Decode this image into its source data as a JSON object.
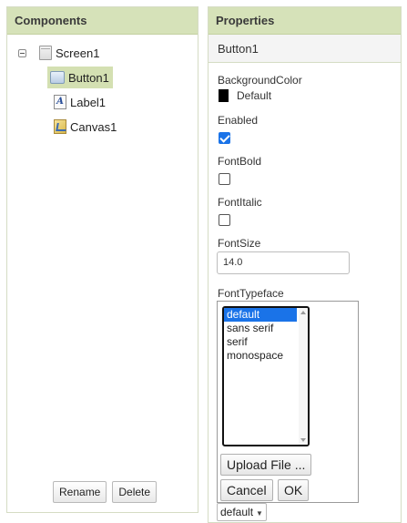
{
  "components_panel": {
    "title": "Components",
    "tree": {
      "root": {
        "label": "Screen1",
        "icon": "screen-icon"
      },
      "children": [
        {
          "label": "Button1",
          "icon": "button-component-icon",
          "selected": true
        },
        {
          "label": "Label1",
          "icon": "label-component-icon",
          "selected": false
        },
        {
          "label": "Canvas1",
          "icon": "canvas-component-icon",
          "selected": false
        }
      ]
    },
    "rename_label": "Rename",
    "delete_label": "Delete"
  },
  "properties_panel": {
    "title": "Properties",
    "component_name": "Button1",
    "background_color": {
      "label": "BackgroundColor",
      "value": "Default",
      "swatch": "#000000"
    },
    "enabled": {
      "label": "Enabled",
      "checked": true
    },
    "font_bold": {
      "label": "FontBold",
      "checked": false
    },
    "font_italic": {
      "label": "FontItalic",
      "checked": false
    },
    "font_size": {
      "label": "FontSize",
      "value": "14.0"
    },
    "font_typeface": {
      "label": "FontTypeface",
      "options": [
        "default",
        "sans serif",
        "serif",
        "monospace"
      ],
      "selected": "default",
      "upload_label": "Upload File ...",
      "cancel_label": "Cancel",
      "ok_label": "OK",
      "dropdown_value": "default"
    }
  },
  "colors": {
    "header_bg": "#d6e2b9",
    "selected_node_bg": "#d4e0b2",
    "selection_blue": "#1a73e8"
  }
}
